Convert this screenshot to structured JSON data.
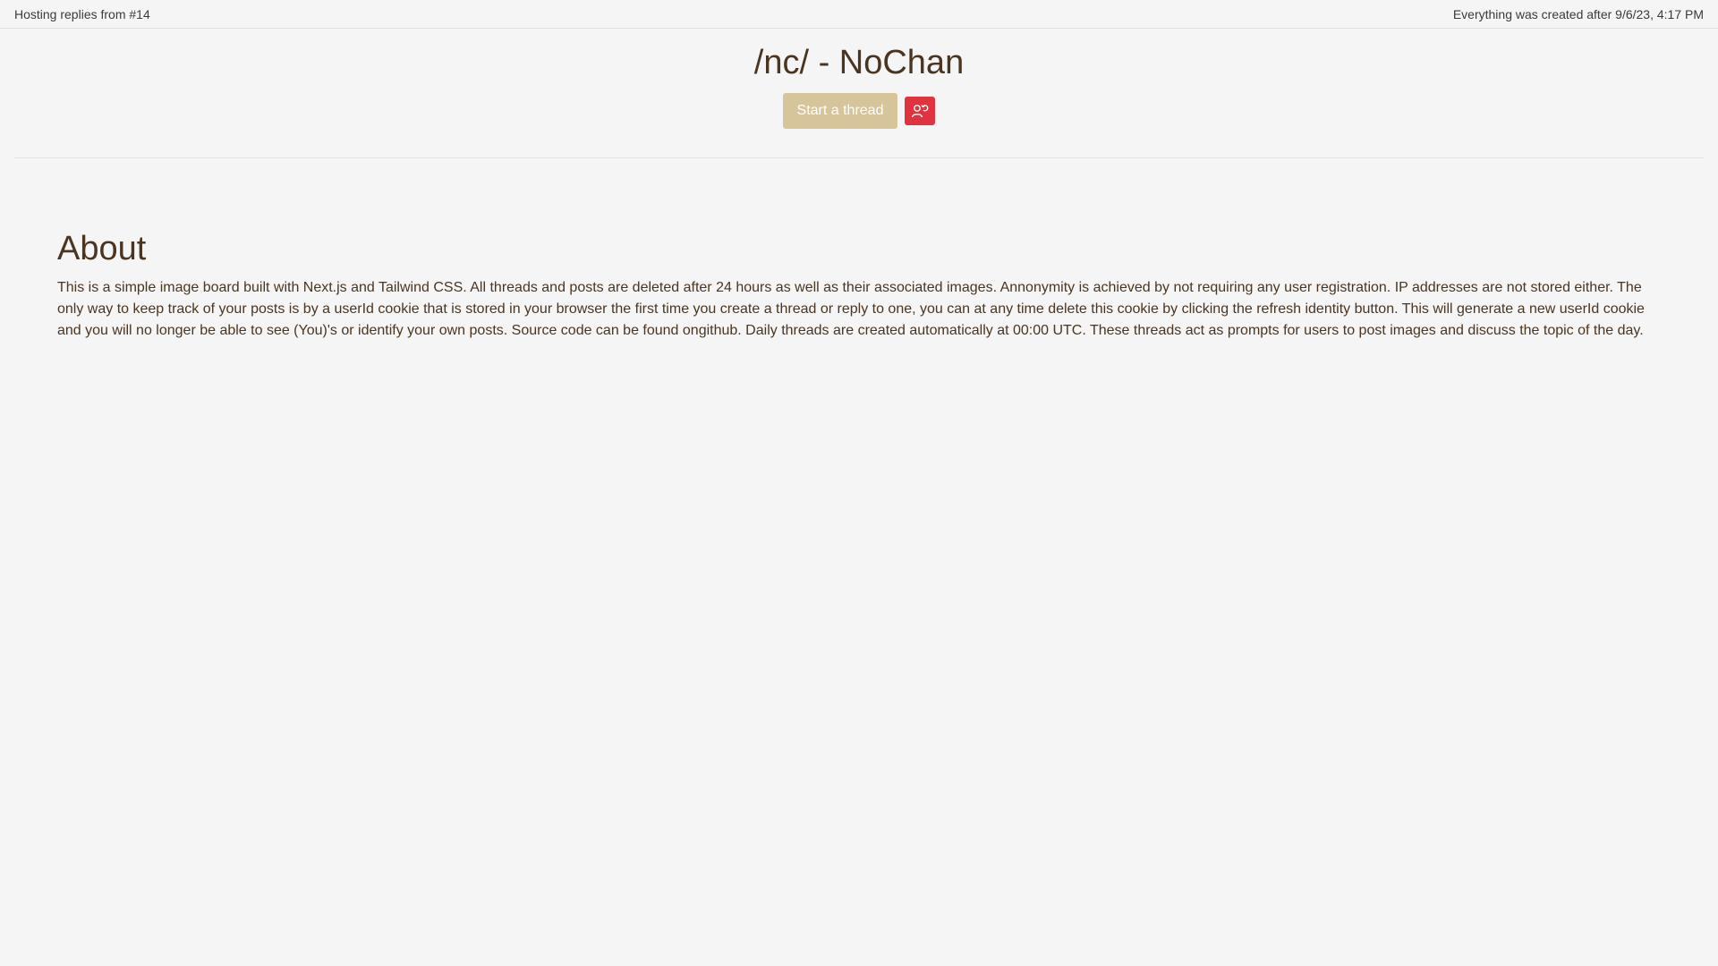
{
  "topbar": {
    "hosting_text": "Hosting replies from #14",
    "created_text": "Everything was created after 9/6/23, 4:17 PM"
  },
  "header": {
    "title": "/nc/ - NoChan",
    "start_thread_label": "Start a thread",
    "refresh_identity_icon": "user-refresh-icon"
  },
  "about": {
    "heading": "About",
    "body": "This is a simple image board built with Next.js and Tailwind CSS. All threads and posts are deleted after 24 hours as well as their associated images. Annonymity is achieved by not requiring any user registration. IP addresses are not stored either. The only way to keep track of your posts is by a userId cookie that is stored in your browser the first time you create a thread or reply to one, you can at any time delete this cookie by clicking the refresh identity button. This will generate a new userId cookie and you will no longer be able to see (You)'s or identify your own posts. Source code can be found ongithub. Daily threads are created automatically at 00:00 UTC. These threads act as prompts for users to post images and discuss the topic of the day."
  },
  "colors": {
    "background": "#f5f5f5",
    "text": "#4a3520",
    "start_button": "#d6c49a",
    "refresh_button": "#e0333f"
  }
}
